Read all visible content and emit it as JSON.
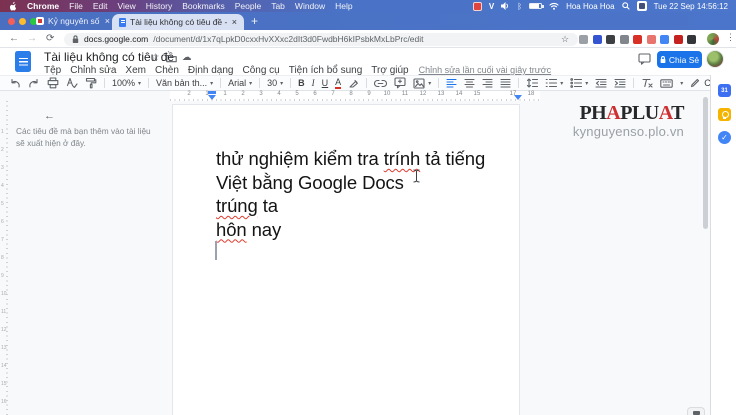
{
  "colors": {
    "accent": "#1a73e8",
    "error_underline": "#e03b2f",
    "keep_yellow": "#f5b400",
    "tabstrip_blue": "#4a72c6"
  },
  "menubar": {
    "app": "Chrome",
    "items": [
      "File",
      "Edit",
      "View",
      "History",
      "Bookmarks",
      "People",
      "Tab",
      "Window",
      "Help"
    ],
    "status": {
      "input_v": "V",
      "user": "Hoa Hoa Hoa",
      "clock": "Tue 22 Sep  14:56:12"
    }
  },
  "tabs": {
    "tab1_title": "Kỷ nguyên số | Chuyên mục C...",
    "tab2_title": "Tài liệu không có tiêu đề - Go...",
    "close": "×",
    "new_tab": "+"
  },
  "address": {
    "back": "←",
    "forward": "→",
    "reload": "⟳",
    "domain": "docs.google.com",
    "path": "/document/d/1x7qLpkD0cxxHvXXxc2dIt3d0FwdbH6kIPsbkMxLbPrc/edit",
    "bookmark_star": "☆",
    "ext_colors": [
      "#9aa0a6",
      "#3554d1",
      "#3c4043",
      "#80868b",
      "#d93025",
      "#e8756d",
      "#4285f4",
      "#c5221f",
      "#35363a"
    ],
    "menu_dots": "⋮"
  },
  "docs": {
    "title": "Tài liệu không có tiêu đề",
    "title_icons": {
      "star": "☆",
      "cloud": "☁"
    },
    "menus": [
      "Tệp",
      "Chỉnh sửa",
      "Xem",
      "Chèn",
      "Định dạng",
      "Công cụ",
      "Tiện ích bổ sung",
      "Trợ giúp"
    ],
    "last_edited": "Chỉnh sửa lần cuối vài giây trước",
    "share_label": "Chia Sẻ",
    "toolbar": {
      "zoom": "100%",
      "styles": "Văn bản th...",
      "font": "Arial",
      "size": "30",
      "bold": "B",
      "italic": "I",
      "underline": "U",
      "text_color": "A",
      "mode": "Chỉnh sửa",
      "collapse": "⌃",
      "caret": "▾"
    },
    "ruler_numbers": [
      "2",
      "1",
      "1",
      "2",
      "3",
      "4",
      "5",
      "6",
      "7",
      "8",
      "9",
      "10",
      "11",
      "12",
      "13",
      "14",
      "15",
      "",
      "17",
      "18"
    ],
    "vruler_numbers": [
      "1",
      "2",
      "3",
      "4",
      "5",
      "6",
      "7",
      "8",
      "9",
      "10",
      "11",
      "12",
      "13",
      "14",
      "15",
      "16"
    ],
    "outline": {
      "back_arrow": "←",
      "hint": "Các tiêu đề mà bạn thêm vào tài liệu sẽ xuất hiện ở đây."
    },
    "body": {
      "l1a": "thử nghiệm kiểm tra ",
      "l1err": "trính",
      "l1b": " tả tiếng",
      "l2": "Việt bằng Google Docs",
      "l3err": "trúng",
      "l3b": " ta",
      "l4err": "hôn",
      "l4b": " nay"
    },
    "watermark": {
      "p1": "PH",
      "a1": "A",
      "p2": "PLU",
      "a2": "A",
      "p3": "T",
      "site": "kynguyenso.plo.vn"
    },
    "side_panel": {
      "calendar": "31",
      "tasks_check": "✓"
    }
  }
}
